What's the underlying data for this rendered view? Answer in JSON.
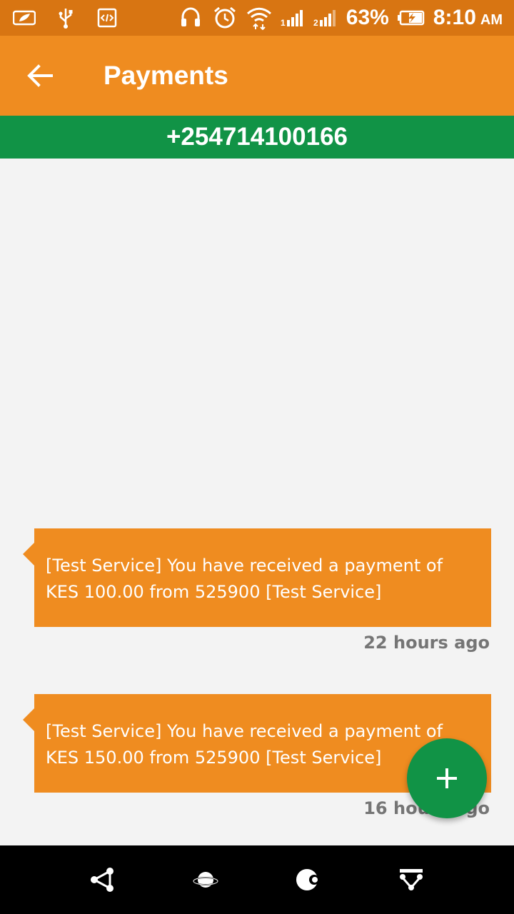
{
  "status_bar": {
    "battery_percent": "63%",
    "time": "8:10",
    "ampm": "AM",
    "icons": [
      "leaf-icon",
      "usb-icon",
      "developer-icon",
      "headset-icon",
      "alarm-icon",
      "wifi-icon",
      "signal-1-icon",
      "signal-2-icon",
      "battery-charging-icon"
    ]
  },
  "app_bar": {
    "title": "Payments",
    "back_icon": "back-arrow-icon"
  },
  "banner": {
    "phone_number": "+254714100166"
  },
  "messages": [
    {
      "text": "[Test Service] You have received a payment of KES 100.00 from 525900 [Test Service]",
      "time": "22 hours ago"
    },
    {
      "text": "[Test Service] You have received a payment of KES 150.00 from 525900 [Test Service]",
      "time": "16 hours ago"
    }
  ],
  "fab": {
    "icon": "plus-icon"
  },
  "nav_bar": {
    "buttons": [
      "share-nav-icon",
      "planet-nav-icon",
      "moon-nav-icon",
      "filter-nav-icon"
    ]
  },
  "colors": {
    "status_bar": "#d87512",
    "app_bar": "#ef8c20",
    "banner": "#119346",
    "bubble": "#ef8c20",
    "fab": "#119346",
    "background": "#f3f3f3"
  }
}
